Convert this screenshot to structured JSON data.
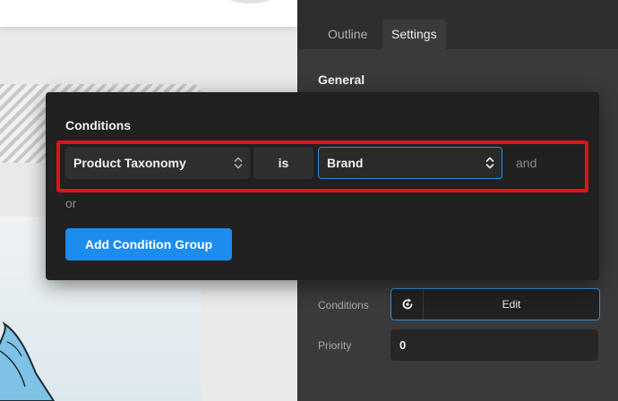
{
  "panel": {
    "tabs": [
      {
        "label": "Outline",
        "active": false
      },
      {
        "label": "Settings",
        "active": true
      }
    ],
    "section_title": "General",
    "conditions_row": {
      "label": "Conditions",
      "edit_label": "Edit",
      "icon": "conditions-edit-icon"
    },
    "priority_row": {
      "label": "Priority",
      "value": "0"
    }
  },
  "popup": {
    "title": "Conditions",
    "condition": {
      "taxonomy": "Product Taxonomy",
      "operator": "is",
      "value": "Brand",
      "join_label": "and"
    },
    "or_label": "or",
    "add_group_label": "Add Condition Group"
  },
  "colors": {
    "accent": "#1d8cef",
    "focus_border": "#2d8ce0",
    "highlight": "#e2111a",
    "popup_bg": "#212121",
    "panel_bg": "#3a3a3a"
  }
}
